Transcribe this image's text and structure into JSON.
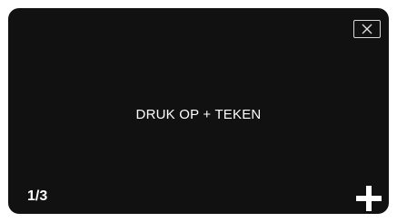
{
  "screen": {
    "message": "DRUK OP + TEKEN",
    "page_counter": "1/3"
  },
  "icons": {
    "close": "close-icon",
    "add": "plus-icon"
  },
  "colors": {
    "background": "#111111",
    "text": "#ffffff",
    "frame": "#d8d8d8"
  }
}
